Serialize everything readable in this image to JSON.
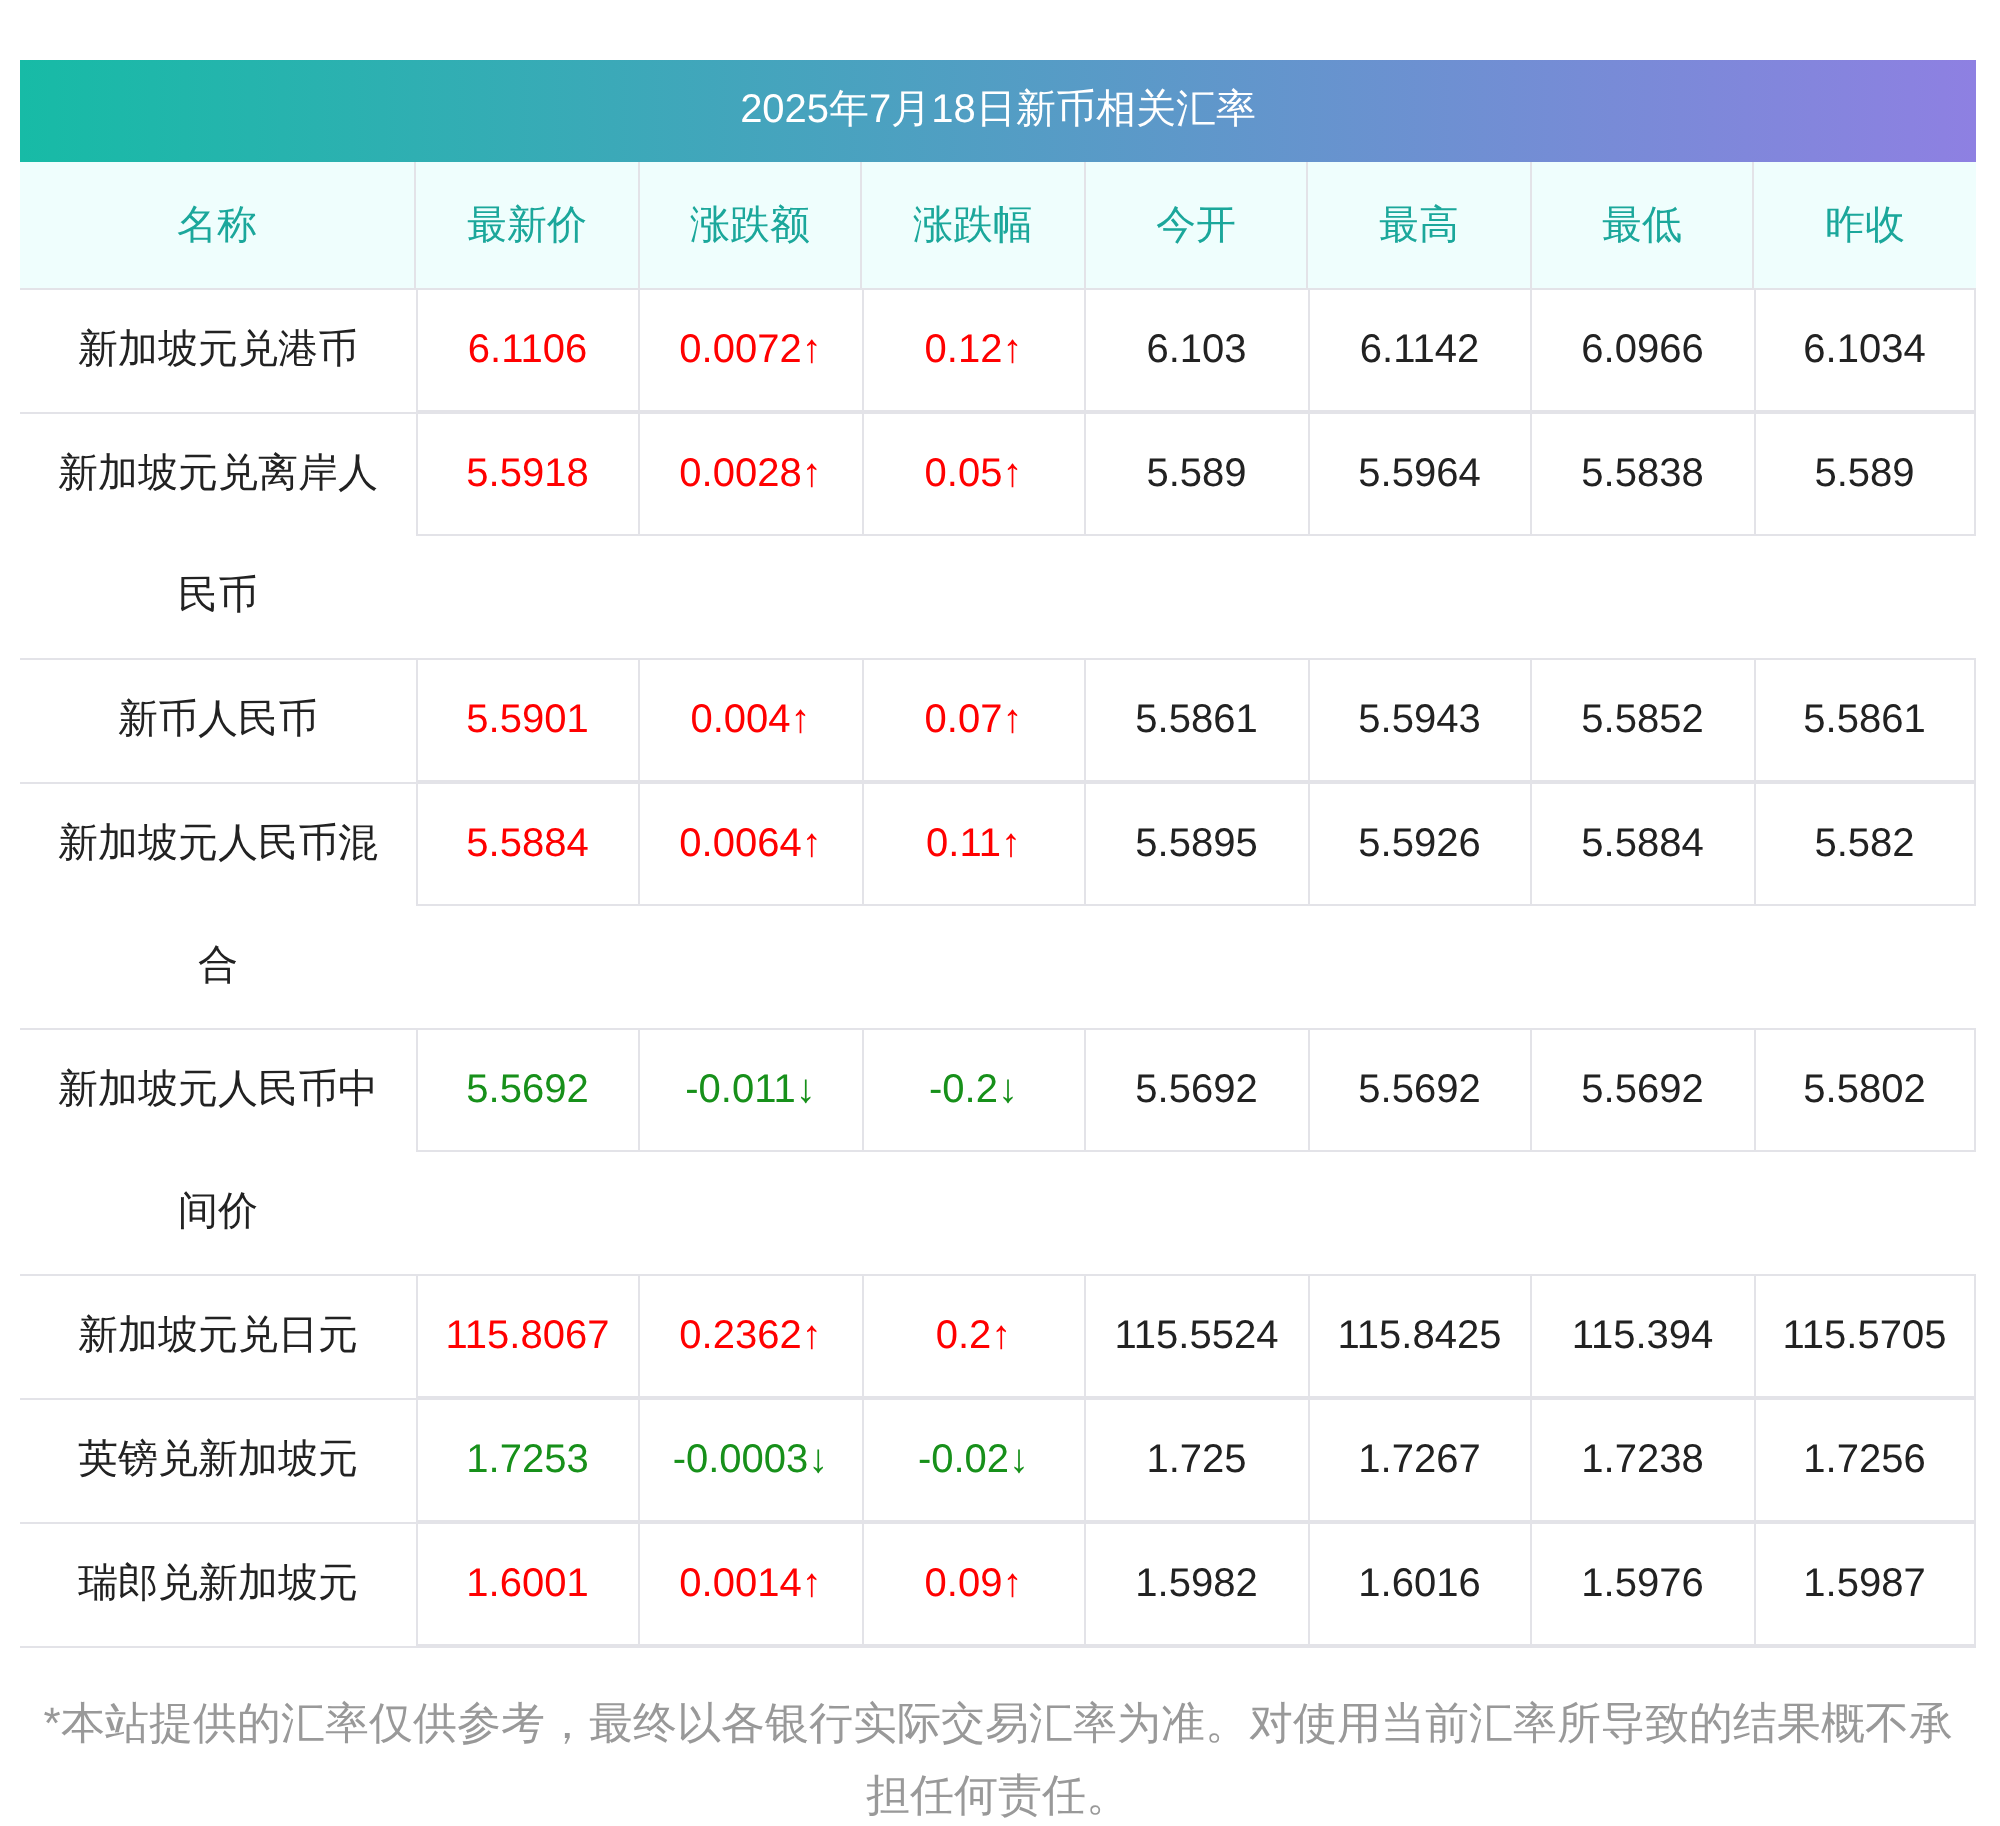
{
  "title": "2025年7月18日新币相关汇率",
  "table": {
    "columns": [
      "名称",
      "最新价",
      "涨跌额",
      "涨跌幅",
      "今开",
      "最高",
      "最低",
      "昨收"
    ],
    "rows": [
      {
        "rising": true,
        "cells": [
          "新加坡元兑港币",
          "6.1106",
          "0.0072↑",
          "0.12↑",
          "6.103",
          "6.1142",
          "6.0966",
          "6.1034"
        ]
      },
      {
        "rising": true,
        "cells": [
          "新加坡元兑离岸人民币",
          "5.5918",
          "0.0028↑",
          "0.05↑",
          "5.589",
          "5.5964",
          "5.5838",
          "5.589"
        ]
      },
      {
        "rising": true,
        "cells": [
          "新币人民币",
          "5.5901",
          "0.004↑",
          "0.07↑",
          "5.5861",
          "5.5943",
          "5.5852",
          "5.5861"
        ]
      },
      {
        "rising": true,
        "cells": [
          "新加坡元人民币混合",
          "5.5884",
          "0.0064↑",
          "0.11↑",
          "5.5895",
          "5.5926",
          "5.5884",
          "5.582"
        ]
      },
      {
        "rising": false,
        "cells": [
          "新加坡元人民币中间价",
          "5.5692",
          "-0.011↓",
          "-0.2↓",
          "5.5692",
          "5.5692",
          "5.5692",
          "5.5802"
        ]
      },
      {
        "rising": true,
        "cells": [
          "新加坡元兑日元",
          "115.8067",
          "0.2362↑",
          "0.2↑",
          "115.5524",
          "115.8425",
          "115.394",
          "115.5705"
        ]
      },
      {
        "rising": false,
        "cells": [
          "英镑兑新加坡元",
          "1.7253",
          "-0.0003↓",
          "-0.02↓",
          "1.725",
          "1.7267",
          "1.7238",
          "1.7256"
        ]
      },
      {
        "rising": true,
        "cells": [
          "瑞郎兑新加坡元",
          "1.6001",
          "0.0014↑",
          "0.09↑",
          "1.5982",
          "1.6016",
          "1.5976",
          "1.5987"
        ]
      }
    ]
  },
  "footnote": "*本站提供的汇率仅供参考，最终以各银行实际交易汇率为准。对使用当前汇率所导致的结果概不承担任何责任。"
}
